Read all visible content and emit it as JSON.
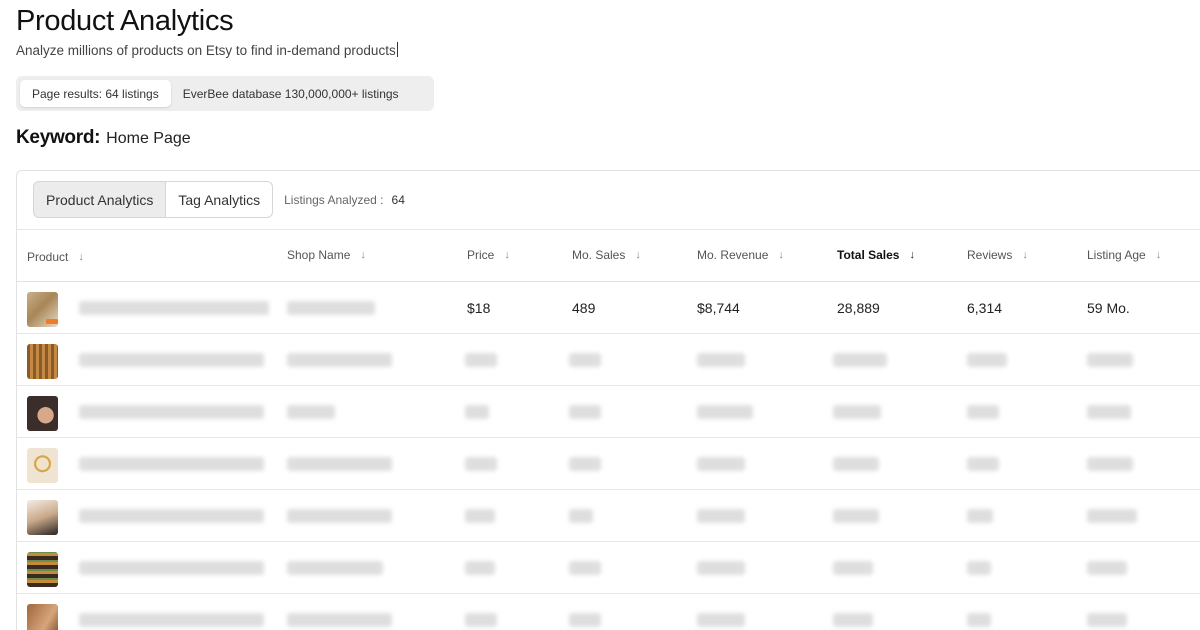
{
  "header": {
    "title": "Product Analytics",
    "subtitle": "Analyze millions of products on Etsy to find in-demand products"
  },
  "scope_toggle": {
    "options": [
      "Page results: 64 listings",
      "EverBee database 130,000,000+ listings"
    ],
    "active_index": 0
  },
  "keyword": {
    "label": "Keyword:",
    "value": "Home Page"
  },
  "tabs": {
    "product": "Product Analytics",
    "tag": "Tag Analytics",
    "active": "product"
  },
  "listings_analyzed": {
    "label": "Listings Analyzed :",
    "value": "64"
  },
  "table": {
    "columns": [
      {
        "label": "Product"
      },
      {
        "label": "Shop Name"
      },
      {
        "label": "Price"
      },
      {
        "label": "Mo. Sales"
      },
      {
        "label": "Mo. Revenue"
      },
      {
        "label": "Total Sales",
        "active_sort": true
      },
      {
        "label": "Reviews"
      },
      {
        "label": "Listing Age"
      }
    ],
    "first_row": {
      "price": "$18",
      "mo_sales": "489",
      "mo_revenue": "$8,744",
      "total_sales": "28,889",
      "reviews": "6,314",
      "listing_age": "59 Mo."
    }
  },
  "icons": {
    "sort": "arrow-down-icon"
  },
  "colors": {
    "panel_border": "#e2e2e2",
    "toggle_bg": "#eeeeee",
    "active_tab_bg": "#ececec"
  }
}
